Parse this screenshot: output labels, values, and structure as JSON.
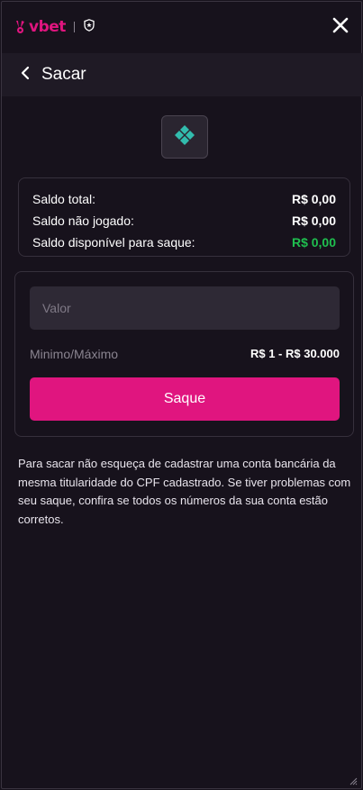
{
  "header": {
    "brand": "vbet",
    "close_icon": "close-icon",
    "brand_badge_icon": "shield-star-icon"
  },
  "subheader": {
    "back_icon": "chevron-left-icon",
    "title": "Sacar"
  },
  "payment_method": {
    "icon": "pix-icon",
    "accent_color": "#32bcad"
  },
  "balances": [
    {
      "label": "Saldo total:",
      "value": "R$ 0,00"
    },
    {
      "label": "Saldo não jogado:",
      "value": "R$ 0,00"
    },
    {
      "label": "Saldo disponível para saque:",
      "value": "R$ 0,00",
      "color": "#1fbf4f"
    }
  ],
  "withdraw": {
    "amount_placeholder": "Valor",
    "amount_value": "",
    "limits_label": "Minimo/Máximo",
    "limits_value": "R$ 1 - R$ 30.000",
    "submit_label": "Saque"
  },
  "info": "Para sacar não esqueça de cadastrar uma conta bancária da mesma titularidade do CPF cadastrado. Se tiver problemas com seu saque, confira se todos os números da sua conta estão corretos.",
  "colors": {
    "background": "#17121c",
    "brand": "#e0157f",
    "panel": "#2e2935"
  }
}
